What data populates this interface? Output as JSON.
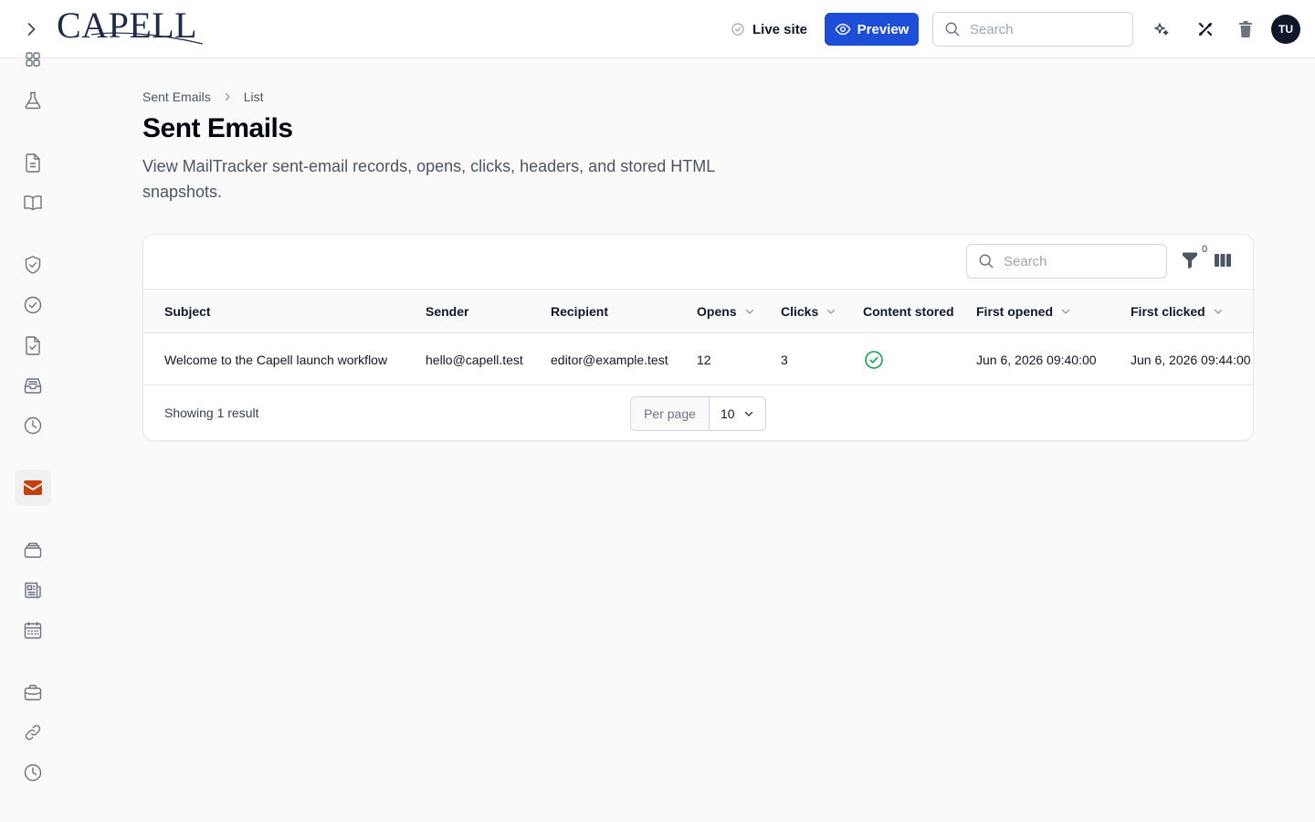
{
  "header": {
    "logo_text": "CAPELL",
    "live_site_label": "Live site",
    "preview_label": "Preview",
    "search_placeholder": "Search",
    "avatar_initials": "TU"
  },
  "sidebar": {
    "items": [
      {
        "icon": "grid-icon"
      },
      {
        "icon": "flask-icon"
      },
      {
        "icon": "document-icon"
      },
      {
        "icon": "book-icon"
      },
      {
        "icon": "shield-check-icon"
      },
      {
        "icon": "check-circle-icon"
      },
      {
        "icon": "document-check-icon"
      },
      {
        "icon": "inbox-icon"
      },
      {
        "icon": "clock-icon"
      },
      {
        "icon": "envelope-icon",
        "active": true
      },
      {
        "icon": "stack-icon"
      },
      {
        "icon": "newspaper-icon"
      },
      {
        "icon": "calendar-icon"
      },
      {
        "icon": "briefcase-icon"
      },
      {
        "icon": "link-icon"
      },
      {
        "icon": "history-icon"
      }
    ]
  },
  "breadcrumb": {
    "parent": "Sent Emails",
    "current": "List"
  },
  "page": {
    "title": "Sent Emails",
    "description": "View MailTracker sent-email records, opens, clicks, headers, and stored HTML snapshots."
  },
  "table": {
    "search_placeholder": "Search",
    "filter_count": "0",
    "columns": [
      {
        "label": "Subject",
        "sortable": false
      },
      {
        "label": "Sender",
        "sortable": false
      },
      {
        "label": "Recipient",
        "sortable": false
      },
      {
        "label": "Opens",
        "sortable": true
      },
      {
        "label": "Clicks",
        "sortable": true
      },
      {
        "label": "Content stored",
        "sortable": false
      },
      {
        "label": "First opened",
        "sortable": true
      },
      {
        "label": "First clicked",
        "sortable": true
      }
    ],
    "rows": [
      {
        "subject": "Welcome to the Capell launch workflow",
        "sender": "hello@capell.test",
        "recipient": "editor@example.test",
        "opens": "12",
        "clicks": "3",
        "content_stored": true,
        "first_opened": "Jun 6, 2026 09:40:00",
        "first_clicked": "Jun 6, 2026 09:44:00"
      }
    ],
    "footer": {
      "results_text": "Showing 1 result",
      "per_page_label": "Per page",
      "per_page_value": "10"
    }
  },
  "colors": {
    "primary": "#1d4ed8",
    "active_nav": "#c2410c",
    "success": "#16a34a"
  }
}
